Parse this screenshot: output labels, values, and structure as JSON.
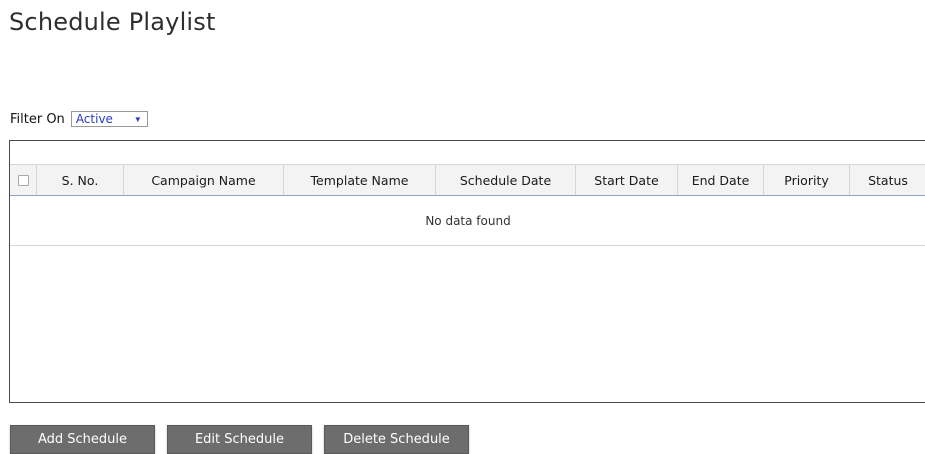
{
  "page": {
    "title": "Schedule Playlist"
  },
  "filter": {
    "label": "Filter On",
    "selected": "Active",
    "arrow_icon": "dropdown-triangle"
  },
  "table": {
    "columns": [
      {
        "key": "select",
        "label": ""
      },
      {
        "key": "sno",
        "label": "S. No."
      },
      {
        "key": "campaign",
        "label": "Campaign Name"
      },
      {
        "key": "template",
        "label": "Template Name"
      },
      {
        "key": "schedule",
        "label": "Schedule Date"
      },
      {
        "key": "start",
        "label": "Start Date"
      },
      {
        "key": "end",
        "label": "End Date"
      },
      {
        "key": "priority",
        "label": "Priority"
      },
      {
        "key": "status",
        "label": "Status"
      }
    ],
    "rows": [],
    "empty_message": "No data found"
  },
  "actions": {
    "add_label": "Add Schedule",
    "edit_label": "Edit Schedule",
    "delete_label": "Delete Schedule"
  },
  "colors": {
    "button_bg": "#6d6d6d",
    "select_text": "#2a39c9",
    "header_bg": "#f3f3f3"
  }
}
